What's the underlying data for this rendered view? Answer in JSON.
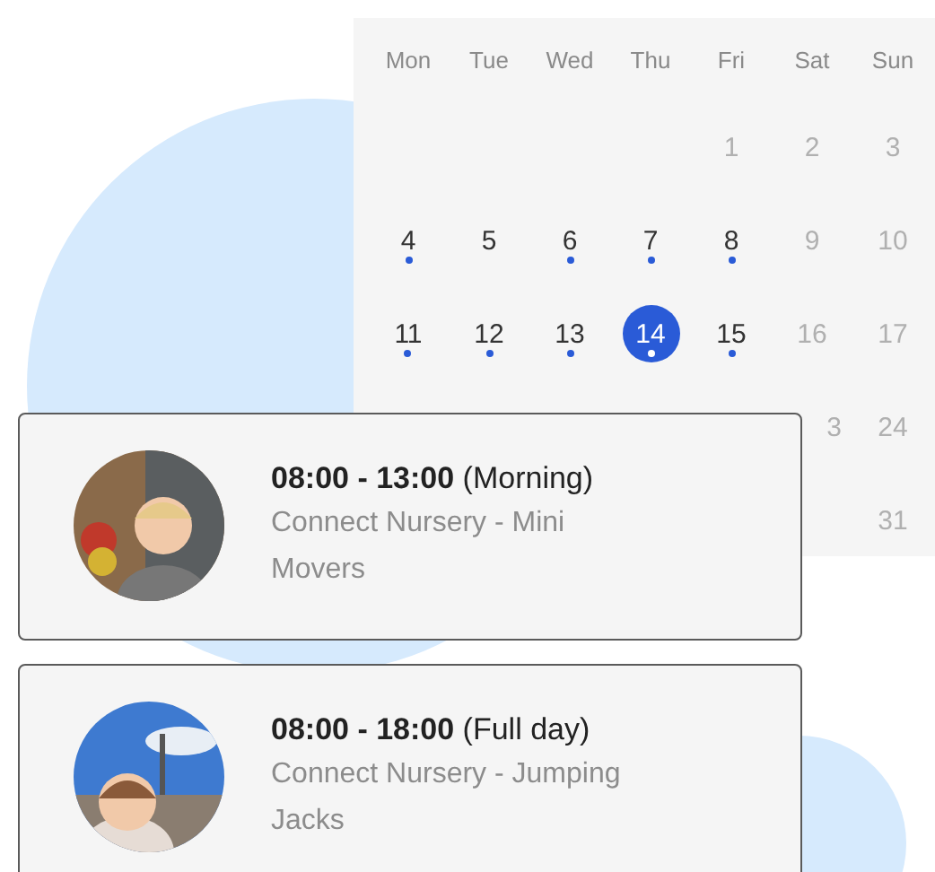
{
  "calendar": {
    "weekdays": [
      "Mon",
      "Tue",
      "Wed",
      "Thu",
      "Fri",
      "Sat",
      "Sun"
    ],
    "weeks": [
      [
        {
          "kind": "blank"
        },
        {
          "kind": "blank"
        },
        {
          "kind": "blank"
        },
        {
          "kind": "blank"
        },
        {
          "kind": "day",
          "day": "1",
          "muted": true,
          "event": false,
          "selected": false
        },
        {
          "kind": "day",
          "day": "2",
          "muted": true,
          "event": false,
          "selected": false
        },
        {
          "kind": "day",
          "day": "3",
          "muted": true,
          "event": false,
          "selected": false
        }
      ],
      [
        {
          "kind": "day",
          "day": "4",
          "muted": false,
          "event": true,
          "selected": false
        },
        {
          "kind": "day",
          "day": "5",
          "muted": false,
          "event": false,
          "selected": false
        },
        {
          "kind": "day",
          "day": "6",
          "muted": false,
          "event": true,
          "selected": false
        },
        {
          "kind": "day",
          "day": "7",
          "muted": false,
          "event": true,
          "selected": false
        },
        {
          "kind": "day",
          "day": "8",
          "muted": false,
          "event": true,
          "selected": false
        },
        {
          "kind": "day",
          "day": "9",
          "muted": true,
          "event": false,
          "selected": false
        },
        {
          "kind": "day",
          "day": "10",
          "muted": true,
          "event": false,
          "selected": false
        }
      ],
      [
        {
          "kind": "day",
          "day": "11",
          "muted": false,
          "event": true,
          "selected": false
        },
        {
          "kind": "day",
          "day": "12",
          "muted": false,
          "event": true,
          "selected": false
        },
        {
          "kind": "day",
          "day": "13",
          "muted": false,
          "event": true,
          "selected": false
        },
        {
          "kind": "day",
          "day": "14",
          "muted": false,
          "event": true,
          "selected": true
        },
        {
          "kind": "day",
          "day": "15",
          "muted": false,
          "event": true,
          "selected": false
        },
        {
          "kind": "day",
          "day": "16",
          "muted": true,
          "event": false,
          "selected": false
        },
        {
          "kind": "day",
          "day": "17",
          "muted": true,
          "event": false,
          "selected": false
        }
      ],
      [
        {
          "kind": "blank"
        },
        {
          "kind": "blank"
        },
        {
          "kind": "blank"
        },
        {
          "kind": "blank"
        },
        {
          "kind": "blank"
        },
        {
          "kind": "partial",
          "day": "3",
          "muted": true,
          "event": false,
          "selected": false
        },
        {
          "kind": "day",
          "day": "24",
          "muted": true,
          "event": false,
          "selected": false
        }
      ],
      [
        {
          "kind": "blank"
        },
        {
          "kind": "blank"
        },
        {
          "kind": "blank"
        },
        {
          "kind": "blank"
        },
        {
          "kind": "blank"
        },
        {
          "kind": "blank"
        },
        {
          "kind": "day",
          "day": "31",
          "muted": true,
          "event": false,
          "selected": false
        }
      ]
    ]
  },
  "bookings": [
    {
      "kind": "picture",
      "time": "**08:00 - 13:00** (Morning)",
      "place": "Connect Nursery - Mini Movers"
    },
    {
      "kind": "picture",
      "time": "**08:00 - 18:00** (Full day)",
      "place": "Connect Nursery - Jumping Jacks"
    }
  ]
}
